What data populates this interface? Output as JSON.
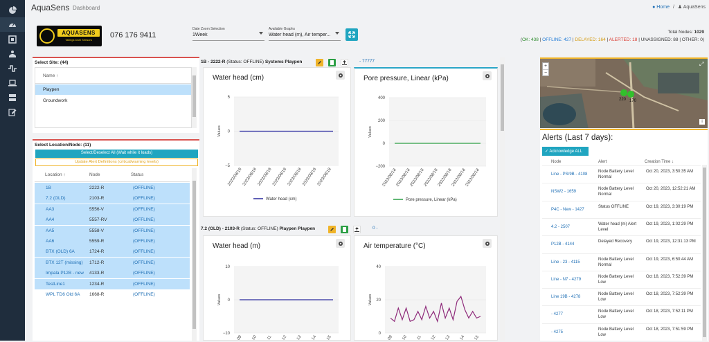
{
  "app": {
    "name": "AquaSens",
    "section": "Dashboard"
  },
  "breadcrumb": {
    "home": "Home",
    "separator": "/",
    "current": "AquaSens"
  },
  "header": {
    "phone": "076 176 9411",
    "logo_text": "AQUASENS",
    "logo_sub": "Tailings Dam Sensors",
    "date_zoom": {
      "label": "Date Zoom Selection",
      "value": "1Week"
    },
    "graphs": {
      "label": "Available Graphs",
      "value": "Water head (m), Air temper..."
    },
    "total_nodes_label": "Total Nodes:",
    "total_nodes": "1029",
    "status": {
      "ok": "OK: 438",
      "offline": "OFFLINE: 427",
      "delayed": "DELAYED: 164",
      "alerted": "ALERTED: 18",
      "unassigned": "UNASSIGNED: 88",
      "other": "OTHER: 0"
    }
  },
  "sites": {
    "title": "Select Site: (44)",
    "col_name": "Name",
    "items": [
      "Playpen",
      "Groundwork"
    ]
  },
  "nodes": {
    "title": "Select Location/Node: (11)",
    "select_all": "Select/Deselect All (Wait while it loads)",
    "update_alerts": "Update Alert Definitions (critical/warning levels)",
    "col_location": "Location",
    "col_node": "Node",
    "col_status": "Status",
    "rows": [
      {
        "loc": "1B",
        "node": "2222-R",
        "status": "(OFFLINE)"
      },
      {
        "loc": "7.2 (OLD)",
        "node": "2103-R",
        "status": "(OFFLINE)"
      },
      {
        "loc": "AA3",
        "node": "5556-V",
        "status": "(OFFLINE)"
      },
      {
        "loc": "AA4",
        "node": "5557-RV",
        "status": "(OFFLINE)"
      },
      {
        "loc": "AA5",
        "node": "5558-V",
        "status": "(OFFLINE)"
      },
      {
        "loc": "AA6",
        "node": "5559-R",
        "status": "(OFFLINE)"
      },
      {
        "loc": "BTX (OLD) 6A",
        "node": "1724-R",
        "status": "(OFFLINE)"
      },
      {
        "loc": "BTX 12T (missing)",
        "node": "1712-R",
        "status": "(OFFLINE)"
      },
      {
        "loc": "Impala P12B - new",
        "node": "4133-R",
        "status": "(OFFLINE)"
      },
      {
        "loc": "TestLine1",
        "node": "1234-R",
        "status": "(OFFLINE)"
      },
      {
        "loc": "WPL TD6 Old 6A",
        "node": "1668-R",
        "status": "(OFFLINE)"
      }
    ]
  },
  "group1": {
    "node_id": "1B - 2222-R",
    "status_text": "(Status: OFFLINE)",
    "site": "Systems Playpen",
    "link": "- 77777"
  },
  "group2": {
    "node_id": "7.2 (OLD) - 2103-R",
    "status_text": "(Status: OFFLINE)",
    "site": "Playpen Playpen",
    "link": "0 -"
  },
  "chart_data": [
    {
      "type": "line",
      "title": "Water head (cm)",
      "ylabel": "Values",
      "x": [
        "2023/08/18",
        "2023/08/18",
        "2023/08/18",
        "2023/08/18",
        "2023/08/18",
        "2023/08/18",
        "2023/08/18"
      ],
      "yticks": [
        5,
        0,
        -5
      ],
      "ylim": [
        -5,
        5
      ],
      "series": [
        {
          "name": "Water head (cm)",
          "color": "#2a2a9e",
          "values": [
            0,
            0,
            0,
            0,
            0,
            0,
            0
          ]
        }
      ]
    },
    {
      "type": "line",
      "title": "Pore pressure, Linear (kPa)",
      "ylabel": "Values",
      "x": [
        "2023/08/18",
        "2023/08/18",
        "2023/08/18",
        "2023/08/18",
        "2023/08/18",
        "2023/08/18",
        "2023/08/18"
      ],
      "yticks": [
        400,
        200,
        0,
        -200
      ],
      "ylim": [
        -200,
        400
      ],
      "series": [
        {
          "name": "Pore pressure, Linear (kPa)",
          "color": "#2c9f45",
          "values": [
            0,
            0,
            0,
            0,
            0,
            0,
            0
          ]
        }
      ]
    },
    {
      "type": "line",
      "title": "Water head (m)",
      "ylabel": "Values",
      "x": [
        "09",
        "10",
        "11",
        "12",
        "13",
        "14",
        "15"
      ],
      "yticks": [
        10,
        0,
        -10
      ],
      "ylim": [
        -10,
        10
      ],
      "series": [
        {
          "color": "#2a2a9e",
          "values": [
            0,
            0,
            0,
            0,
            0,
            0,
            0
          ]
        }
      ]
    },
    {
      "type": "line",
      "title": "Air temperature (°C)",
      "ylabel": "Values",
      "x": [
        "09",
        "10",
        "11",
        "12",
        "13",
        "14",
        "15"
      ],
      "yticks": [
        40,
        20,
        0
      ],
      "ylim": [
        0,
        40
      ],
      "series": [
        {
          "color": "#8e2a7a",
          "values": [
            9,
            7,
            15,
            8,
            15,
            7,
            8,
            13,
            8,
            16,
            9,
            13,
            7,
            18,
            9,
            15,
            8,
            19,
            22,
            14,
            9,
            13,
            9,
            10
          ]
        }
      ]
    }
  ],
  "map": {
    "labels": [
      "220",
      "170"
    ]
  },
  "alerts": {
    "title": "Alerts (Last 7 days):",
    "ack_button": "Acknowledge ALL",
    "col_node": "Node",
    "col_alert": "Alert",
    "col_time": "Creation Time",
    "rows": [
      {
        "node": "Line - PS/9B - 4108",
        "alert": "Node Battery Level Normal",
        "time": "Oct 20, 2023, 3:50:35 AM"
      },
      {
        "node": "NSW2 - 1659",
        "alert": "Node Battery Level Normal",
        "time": "Oct 20, 2023, 12:52:21 AM"
      },
      {
        "node": "P4C - New - 1427",
        "alert": "Status OFFLINE",
        "time": "Oct 19, 2023, 3:30:19 PM"
      },
      {
        "node": "4.2 - 2507",
        "alert": "Water head (m) Alert Level",
        "time": "Oct 19, 2023, 1:02:29 PM"
      },
      {
        "node": "P12B - 4144",
        "alert": "Delayed Recovery",
        "time": "Oct 19, 2023, 12:31:13 PM"
      },
      {
        "node": "Line - 23 - 4115",
        "alert": "Node Battery Level Normal",
        "time": "Oct 19, 2023, 6:50:44 AM"
      },
      {
        "node": "Line - N7 - 4279",
        "alert": "Node Battery Level Low",
        "time": "Oct 18, 2023, 7:52:39 PM"
      },
      {
        "node": "Line 19B - 4278",
        "alert": "Node Battery Level Low",
        "time": "Oct 18, 2023, 7:52:39 PM"
      },
      {
        "node": "- 4277",
        "alert": "Node Battery Level Low",
        "time": "Oct 18, 2023, 7:52:11 PM"
      },
      {
        "node": "- 4275",
        "alert": "Node Battery Level Low",
        "time": "Oct 18, 2023, 7:51:59 PM"
      }
    ]
  }
}
